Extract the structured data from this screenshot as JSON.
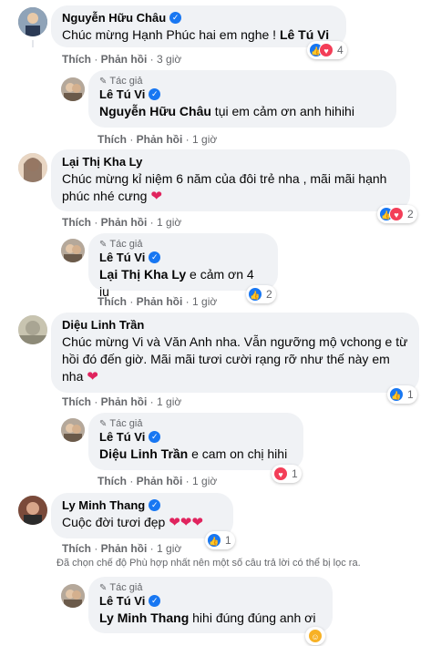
{
  "author_tag": "Tác giả",
  "actions": {
    "like": "Thích",
    "reply": "Phản hồi",
    "sep": "·"
  },
  "comments": [
    {
      "name": "Nguyễn Hữu Châu",
      "text": "Chúc mừng Hạnh Phúc hai em nghe ! ",
      "mention": "Lê Tú Vi",
      "time": "3 giờ",
      "reactions": "4"
    },
    {
      "name": "Lê Tú Vi",
      "mention": "Nguyễn Hữu Châu",
      "text": " tụi em cảm ơn anh hihihi",
      "time": "1 giờ"
    },
    {
      "name": "Lại Thị Kha Ly",
      "text": "Chúc mừng kỉ niệm 6 năm của đôi trẻ nha , mãi mãi hạnh phúc nhé cưng",
      "time": "1 giờ",
      "reactions": "2"
    },
    {
      "name": "Lê Tú Vi",
      "mention": "Lại Thị Kha Ly",
      "text": " e cảm ơn 4 iu",
      "time": "1 giờ",
      "reactions": "2"
    },
    {
      "name": "Diệu Linh Trần",
      "text": "Chúc mừng Vi và Văn Anh nha. Vẫn ngưỡng mộ vchong e từ hồi đó đến giờ. Mãi mãi tươi cười rạng rỡ như thế này em nha",
      "time": "1 giờ",
      "reactions": "1"
    },
    {
      "name": "Lê Tú Vi",
      "mention": "Diệu Linh Trần",
      "text": " e cam on chị hihi",
      "time": "1 giờ",
      "reactions": "1"
    },
    {
      "name": "Ly Minh Thang",
      "text": "Cuộc đời tươi đẹp",
      "time": "1 giờ",
      "reactions": "1"
    },
    {
      "name": "Lê Tú Vi",
      "mention": "Ly Minh Thang",
      "text": " hihi đúng đúng anh ơi",
      "time": "1 giờ"
    }
  ],
  "filter_notice": "Đã chọn chế độ Phù hợp nhất nên một số câu trả lời có thể bị lọc ra.",
  "colors": {
    "bubble": "#f0f2f5",
    "like": "#1877f2",
    "love": "#f33e58",
    "meta": "#65676b"
  }
}
